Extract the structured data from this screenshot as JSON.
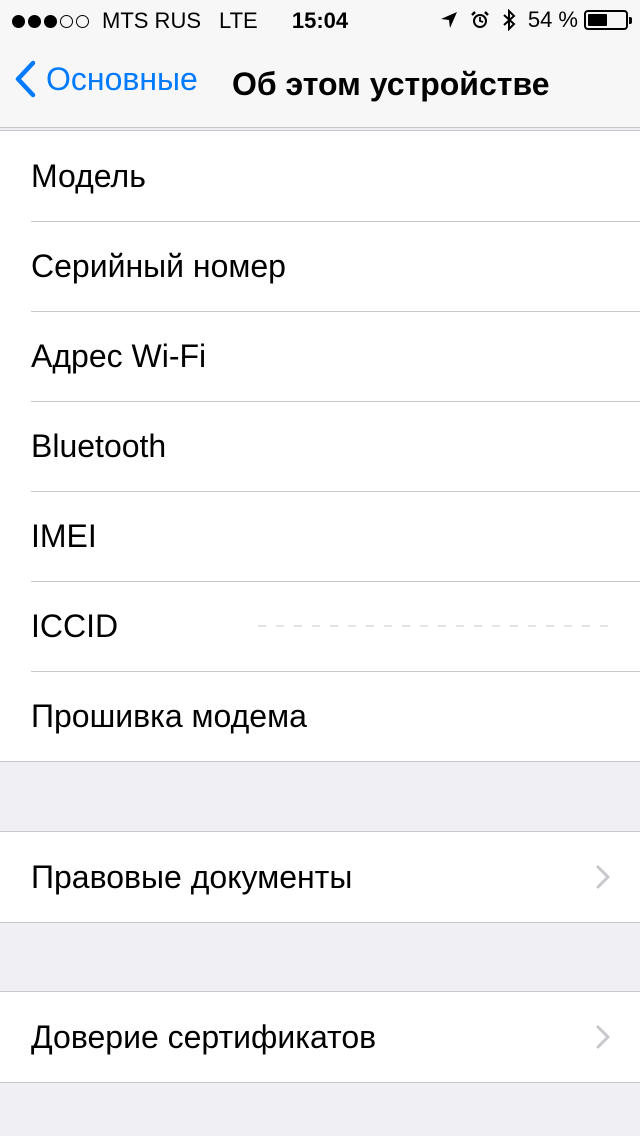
{
  "status_bar": {
    "carrier": "MTS RUS",
    "network": "LTE",
    "time": "15:04",
    "battery_percent": "54 %",
    "battery_level": 0.54,
    "signal_strength": 3,
    "signal_max": 5,
    "icons": [
      "location-arrow-icon",
      "alarm-clock-icon",
      "bluetooth-icon"
    ]
  },
  "nav": {
    "back_label": "Основные",
    "title": "Об этом устройстве"
  },
  "groups": [
    {
      "rows": [
        {
          "label": "Модель"
        },
        {
          "label": "Серийный номер"
        },
        {
          "label": "Адрес Wi-Fi"
        },
        {
          "label": "Bluetooth"
        },
        {
          "label": "IMEI"
        },
        {
          "label": "ICCID"
        },
        {
          "label": "Прошивка модема"
        }
      ]
    },
    {
      "rows": [
        {
          "label": "Правовые документы",
          "disclosure": true
        }
      ]
    },
    {
      "rows": [
        {
          "label": "Доверие сертификатов",
          "disclosure": true
        }
      ]
    }
  ],
  "colors": {
    "accent": "#007aff",
    "background": "#efeff4",
    "separator": "#c8c7cc",
    "chevron": "#c7c7cc"
  }
}
